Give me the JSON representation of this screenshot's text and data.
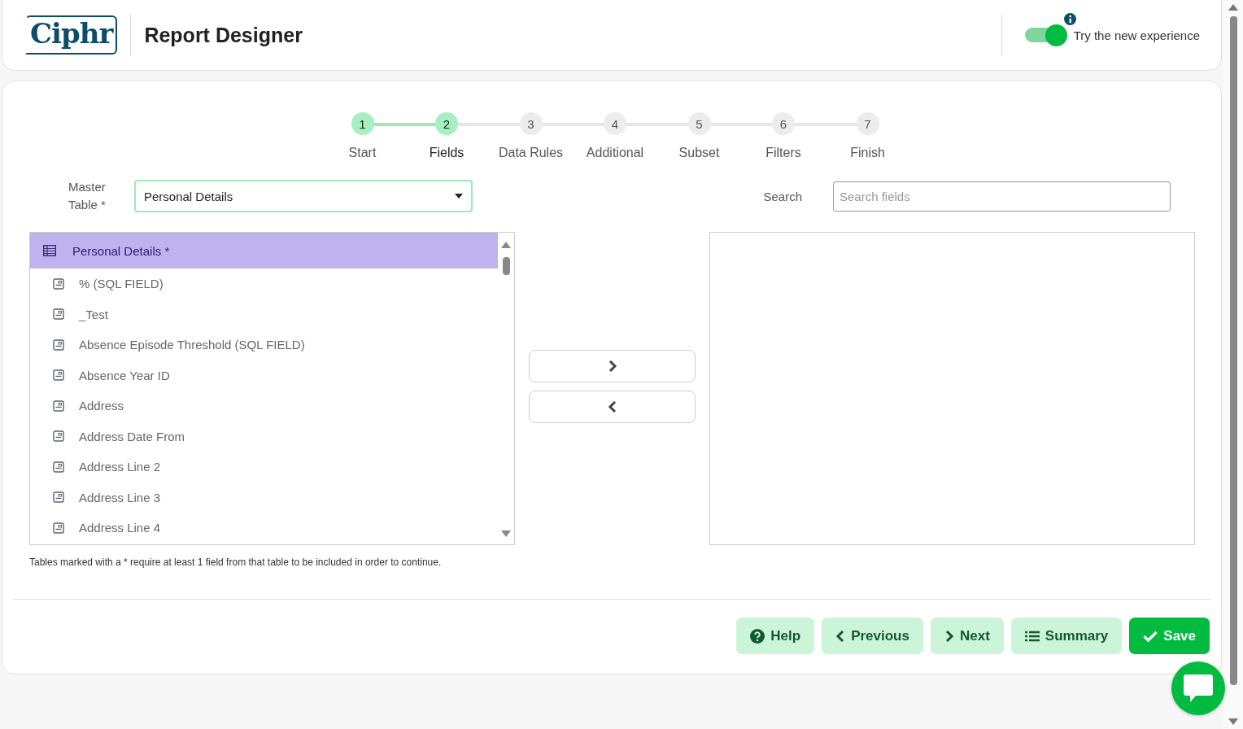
{
  "header": {
    "logo": "Ciphr",
    "title": "Report Designer",
    "toggle": {
      "on": true,
      "label": "Try the new experience"
    }
  },
  "steps": [
    {
      "number": "1",
      "label": "Start",
      "selected": false
    },
    {
      "number": "2",
      "label": "Fields",
      "selected": true
    },
    {
      "number": "3",
      "label": "Data Rules",
      "selected": false
    },
    {
      "number": "4",
      "label": "Additional",
      "selected": false
    },
    {
      "number": "5",
      "label": "Subset",
      "selected": false
    },
    {
      "number": "6",
      "label": "Filters",
      "selected": false
    },
    {
      "number": "7",
      "label": "Finish",
      "selected": false
    }
  ],
  "master_table": {
    "label_line_1": "Master",
    "label_line_2": "Table *",
    "value": "Personal Details"
  },
  "search": {
    "label": "Search",
    "placeholder": "Search fields"
  },
  "available_fields": {
    "table": "Personal Details *",
    "items": [
      {
        "label": "% (SQL FIELD)"
      },
      {
        "label": "_Test"
      },
      {
        "label": "Absence Episode Threshold (SQL FIELD)"
      },
      {
        "label": "Absence Year ID"
      },
      {
        "label": "Address"
      },
      {
        "label": "Address Date From"
      },
      {
        "label": "Address Line 2"
      },
      {
        "label": "Address Line 3"
      },
      {
        "label": "Address Line 4"
      }
    ]
  },
  "note": "Tables marked with a * require at least 1 field from that table to be included in order to continue.",
  "buttons": [
    {
      "kind": "help",
      "label": "Help",
      "primary": false
    },
    {
      "kind": "previous",
      "label": "Previous",
      "primary": false
    },
    {
      "kind": "next",
      "label": "Next",
      "primary": false
    },
    {
      "kind": "summary",
      "label": "Summary",
      "primary": false
    },
    {
      "kind": "save",
      "label": "Save",
      "primary": true
    }
  ]
}
